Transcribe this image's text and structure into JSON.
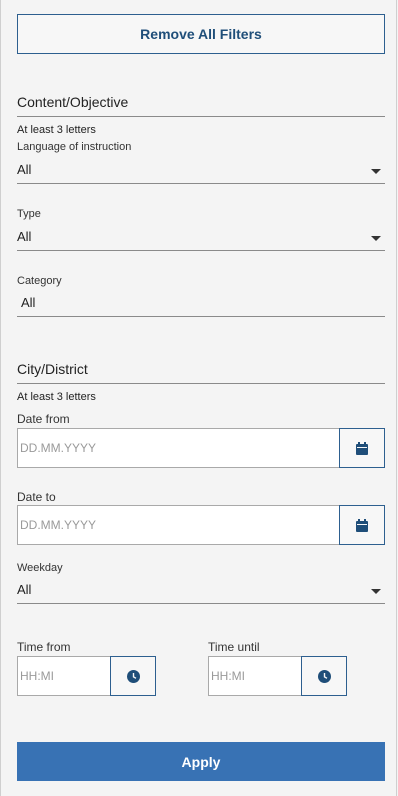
{
  "remove_filters_label": "Remove All Filters",
  "content_objective": {
    "placeholder": "Content/Objective",
    "hint": "At least 3 letters"
  },
  "language": {
    "label": "Language of instruction",
    "value": "All"
  },
  "type": {
    "label": "Type",
    "value": "All"
  },
  "category": {
    "label": "Category",
    "value": "All"
  },
  "city_district": {
    "placeholder": "City/District",
    "hint": "At least 3 letters"
  },
  "date_from": {
    "label": "Date from",
    "placeholder": "DD.MM.YYYY",
    "icon": "calendar-icon"
  },
  "date_to": {
    "label": "Date to",
    "placeholder": "DD.MM.YYYY",
    "icon": "calendar-icon"
  },
  "weekday": {
    "label": "Weekday",
    "value": "All"
  },
  "time_from": {
    "label": "Time from",
    "placeholder": "HH:MI",
    "icon": "clock-icon"
  },
  "time_until": {
    "label": "Time until",
    "placeholder": "HH:MI",
    "icon": "clock-icon"
  },
  "apply_label": "Apply",
  "colors": {
    "primary": "#3872b4",
    "outline": "#2d5f8f",
    "background": "#f4f4f4"
  }
}
